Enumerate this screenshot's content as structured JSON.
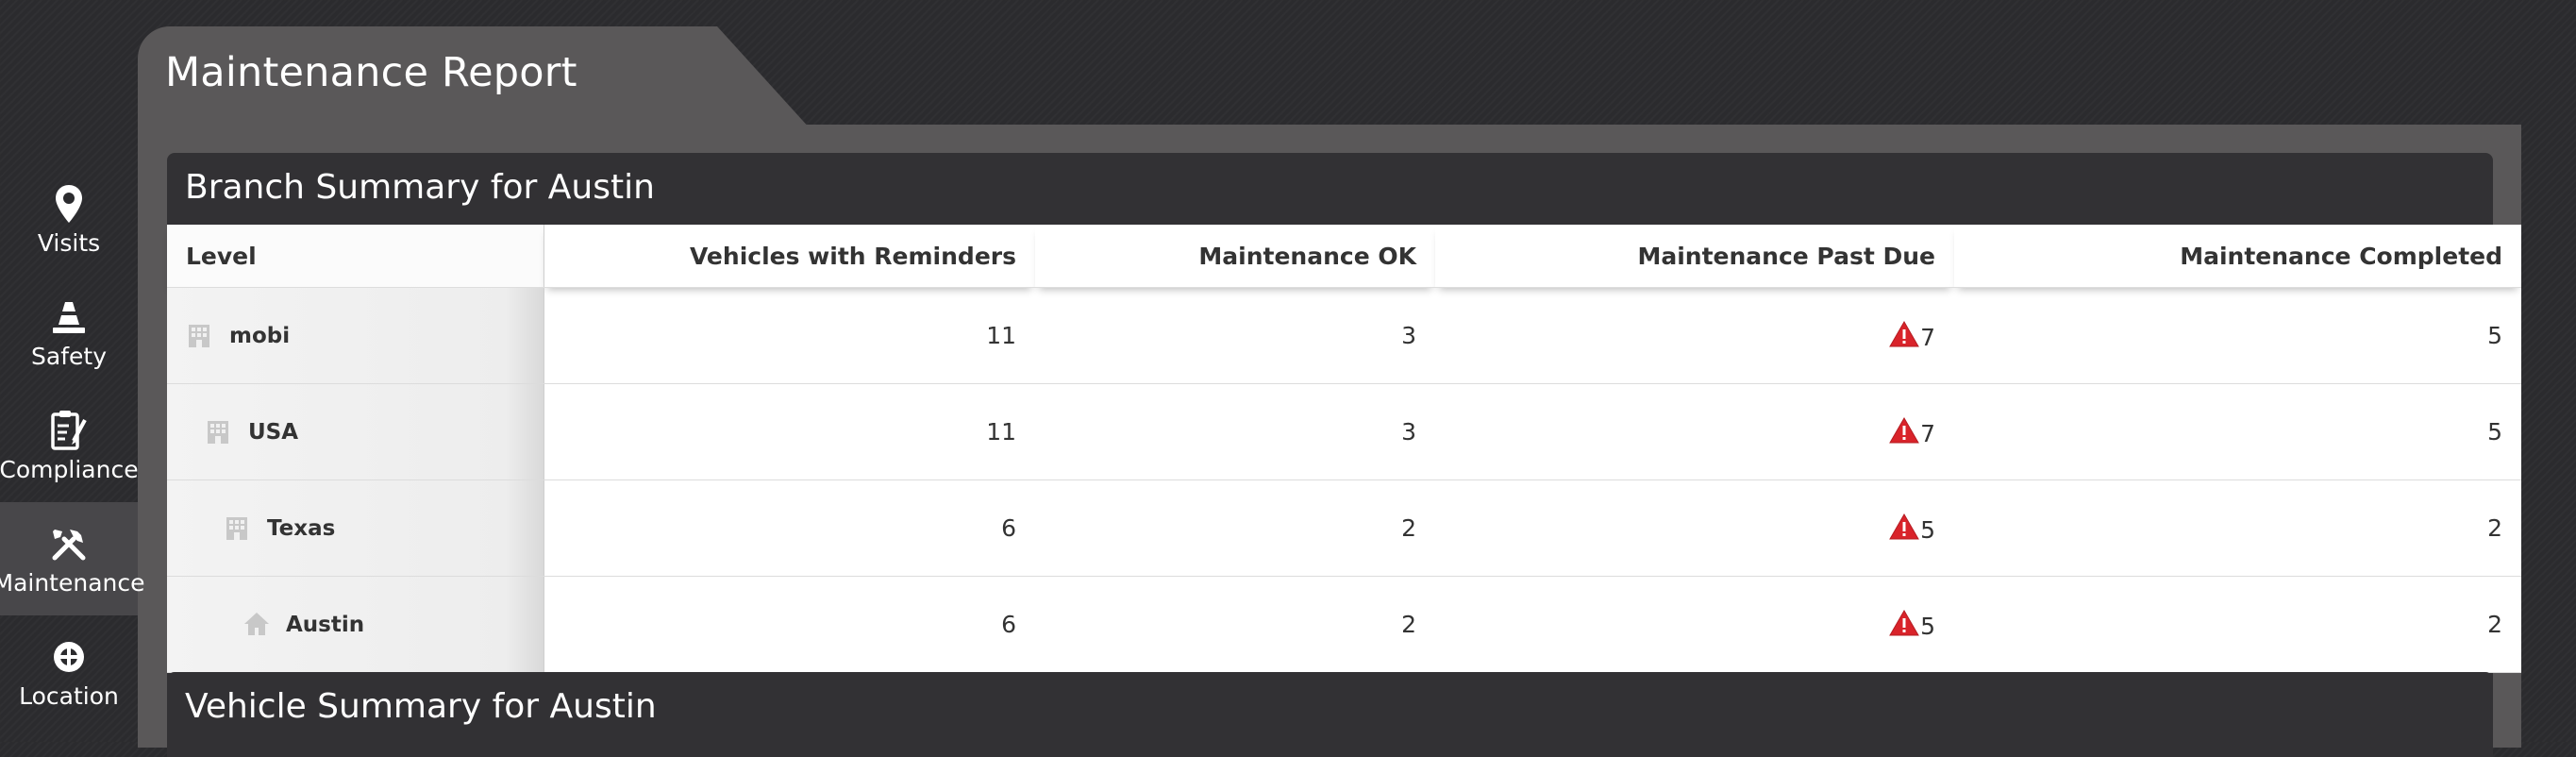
{
  "page": {
    "title": "Maintenance Report"
  },
  "nav": {
    "items": [
      {
        "label": "Visits",
        "icon": "map-pin-icon"
      },
      {
        "label": "Safety",
        "icon": "traffic-cone-icon"
      },
      {
        "label": "Compliance",
        "icon": "clipboard-icon"
      },
      {
        "label": "Maintenance",
        "icon": "tools-icon",
        "active": true
      },
      {
        "label": "Location",
        "icon": "crosshair-icon"
      }
    ]
  },
  "branch_summary": {
    "title": "Branch Summary for Austin",
    "columns": [
      "Level",
      "Vehicles with Reminders",
      "Maintenance OK",
      "Maintenance Past Due",
      "Maintenance Completed"
    ],
    "rows": [
      {
        "level": "mobi",
        "icon": "building-icon",
        "vehicles_with_reminders": "11",
        "maintenance_ok": "3",
        "maintenance_past_due": "7",
        "maintenance_completed": "5"
      },
      {
        "level": "USA",
        "icon": "building-icon",
        "vehicles_with_reminders": "11",
        "maintenance_ok": "3",
        "maintenance_past_due": "7",
        "maintenance_completed": "5"
      },
      {
        "level": "Texas",
        "icon": "building-icon",
        "vehicles_with_reminders": "6",
        "maintenance_ok": "2",
        "maintenance_past_due": "5",
        "maintenance_completed": "2"
      },
      {
        "level": "Austin",
        "icon": "house-icon",
        "vehicles_with_reminders": "6",
        "maintenance_ok": "2",
        "maintenance_past_due": "5",
        "maintenance_completed": "2"
      }
    ]
  },
  "vehicle_summary": {
    "title": "Vehicle Summary for Austin"
  },
  "colors": {
    "warning_red": "#d9232a",
    "background": "#2b2b2e",
    "frame": "#5a5859",
    "panel_header": "#323134",
    "nav_active": "#48474a"
  }
}
